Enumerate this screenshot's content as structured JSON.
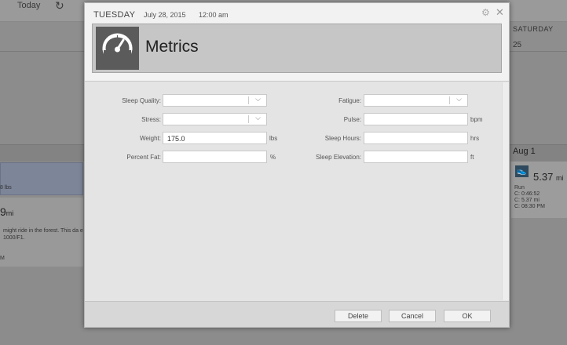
{
  "background": {
    "today_label": "Today",
    "refresh_icon": "refresh-icon",
    "day_header": "SATURDAY",
    "day_number": "25",
    "week_label": "Aug 1",
    "left_card": {
      "weight_text": "8 lbs",
      "distance_value": "9",
      "distance_unit": "mi",
      "note_text": "might ride in the forest. This da e 1000/F1.",
      "tail_text": "M"
    },
    "right_card": {
      "distance_value": "5.37",
      "distance_unit": "mi",
      "activity": "Run",
      "line1": "C: 0:46:52",
      "line2": "C: 5.37 mi",
      "line3": "C: 08:30 PM"
    }
  },
  "modal": {
    "day": "TUESDAY",
    "date": "July 28, 2015",
    "time": "12:00 am",
    "title": "Metrics",
    "icon": "gauge-icon",
    "fields": {
      "sleep_quality": {
        "label": "Sleep Quality:",
        "value": ""
      },
      "stress": {
        "label": "Stress:",
        "value": ""
      },
      "weight": {
        "label": "Weight:",
        "value": "175.0",
        "unit": "lbs"
      },
      "percent_fat": {
        "label": "Percent Fat:",
        "value": "",
        "unit": "%"
      },
      "fatigue": {
        "label": "Fatigue:",
        "value": ""
      },
      "pulse": {
        "label": "Pulse:",
        "value": "",
        "unit": "bpm"
      },
      "sleep_hours": {
        "label": "Sleep Hours:",
        "value": "",
        "unit": "hrs"
      },
      "sleep_elevation": {
        "label": "Sleep Elevation:",
        "value": "",
        "unit": "ft"
      }
    },
    "buttons": {
      "delete": "Delete",
      "cancel": "Cancel",
      "ok": "OK"
    }
  }
}
